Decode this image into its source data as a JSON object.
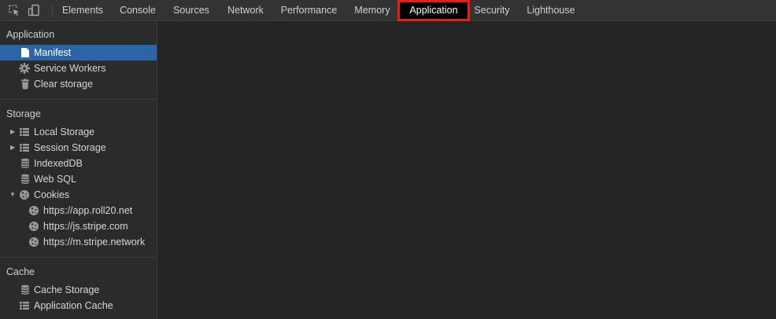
{
  "toolbar": {
    "tabs": [
      "Elements",
      "Console",
      "Sources",
      "Network",
      "Performance",
      "Memory",
      "Application",
      "Security",
      "Lighthouse"
    ],
    "active_tab": "Application",
    "highlight_color": "#e8200e"
  },
  "sidebar": {
    "application": {
      "title": "Application",
      "items": [
        "Manifest",
        "Service Workers",
        "Clear storage"
      ]
    },
    "storage": {
      "title": "Storage",
      "items": [
        "Local Storage",
        "Session Storage",
        "IndexedDB",
        "Web SQL",
        "Cookies"
      ],
      "cookies": [
        "https://app.roll20.net",
        "https://js.stripe.com",
        "https://m.stripe.network"
      ]
    },
    "cache": {
      "title": "Cache",
      "items": [
        "Cache Storage",
        "Application Cache"
      ]
    }
  },
  "colors": {
    "selected": "#2b65a7",
    "sidebar_bg": "#2b2b2b",
    "toolbar_bg": "#333333",
    "panel_bg": "#242424"
  },
  "icons": {
    "inspect": "inspect-element-icon",
    "device": "device-toolbar-icon",
    "manifest": "file-icon",
    "service_workers": "gear-icon",
    "clear_storage": "trash-icon",
    "grid": "table-grid-icon",
    "database": "database-icon",
    "cookie": "cookie-icon"
  }
}
